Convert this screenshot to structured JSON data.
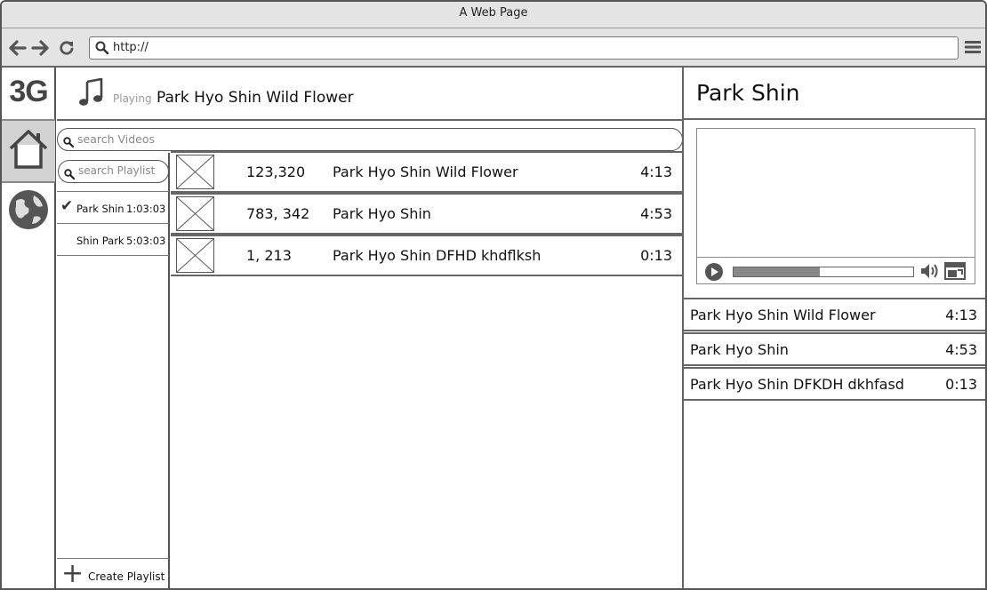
{
  "window": {
    "title": "A Web Page"
  },
  "browser": {
    "url": "http://"
  },
  "app": {
    "logo": "3G"
  },
  "now_playing": {
    "label": "Playing",
    "title": "Park Hyo Shin Wild Flower"
  },
  "search": {
    "videos_placeholder": "search Videos",
    "playlist_placeholder": "search Playlist"
  },
  "playlists": [
    {
      "name": "Park Shin",
      "duration": "1:03:03",
      "selected": true
    },
    {
      "name": "Shin Park",
      "duration": "5:03:03",
      "selected": false
    }
  ],
  "create_playlist_label": "Create Playlist",
  "videos": [
    {
      "views": "123,320",
      "title": "Park Hyo Shin Wild Flower",
      "duration": "4:13"
    },
    {
      "views": "783, 342",
      "title": "Park Hyo Shin",
      "duration": "4:53"
    },
    {
      "views": "1, 213",
      "title": "Park Hyo Shin DFHD khdflksh",
      "duration": "0:13"
    }
  ],
  "right_panel": {
    "title": "Park Shin",
    "player": {
      "progress": 0.48
    },
    "tracks": [
      {
        "title": "Park Hyo Shin Wild Flower",
        "duration": "4:13"
      },
      {
        "title": "Park Hyo Shin",
        "duration": "4:53"
      },
      {
        "title": "Park Hyo Shin DFKDH dkhfasd",
        "duration": "0:13"
      }
    ]
  },
  "icons": {
    "back": "arrow-left-icon",
    "forward": "arrow-right-icon",
    "reload": "reload-icon",
    "menu": "hamburger-menu-icon",
    "home": "home-icon",
    "globe": "globe-icon",
    "music": "music-note-icon",
    "search": "search-icon",
    "check": "checkmark-icon",
    "plus": "plus-icon",
    "play": "play-icon",
    "volume": "volume-icon",
    "fullscreen": "fullscreen-icon"
  }
}
